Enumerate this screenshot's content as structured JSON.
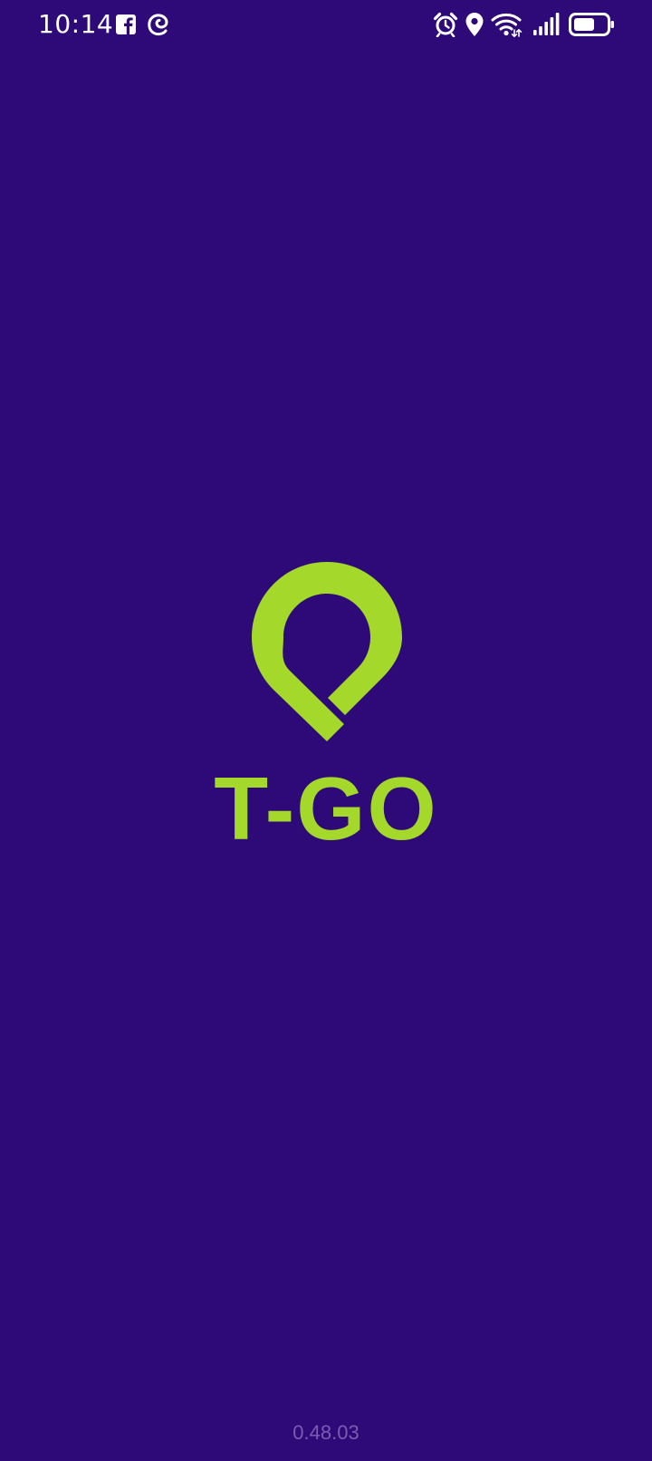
{
  "status_bar": {
    "time": "10:14",
    "left_icons": [
      "facebook-icon",
      "swirl-app-icon"
    ],
    "right_icons": [
      "alarm-icon",
      "location-icon",
      "wifi-icon",
      "signal-icon",
      "battery-icon"
    ]
  },
  "splash": {
    "brand_name": "T-GO",
    "version": "0.48.03"
  },
  "colors": {
    "background": "#2e0a78",
    "brand_accent": "#a4d82a",
    "version_text": "#7d5ab2",
    "status_text": "#ffffff"
  }
}
